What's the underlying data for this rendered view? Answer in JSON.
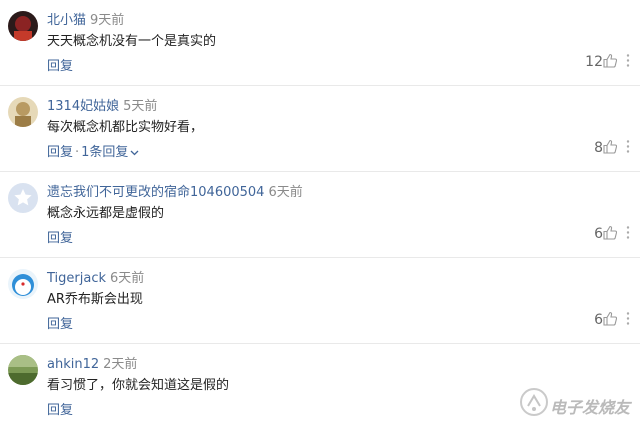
{
  "comments": [
    {
      "username": "北小猫",
      "time": "9天前",
      "text": "天天概念机没有一个是真实的",
      "reply_label": "回复",
      "likes": "12",
      "avatar_color": "#7a1f1f"
    },
    {
      "username": "1314妃姑娘",
      "time": "5天前",
      "text": "每次概念机都比实物好看，",
      "reply_label": "回复",
      "replies_label": "1条回复",
      "likes": "8",
      "avatar_color": "#c9b58a"
    },
    {
      "username": "遗忘我们不可更改的宿命104600504",
      "time": "6天前",
      "text": "概念永远都是虚假的",
      "reply_label": "回复",
      "likes": "6",
      "avatar_color": "#c7d3e6"
    },
    {
      "username": "Tigerjack",
      "time": "6天前",
      "text": "AR乔布斯会出现",
      "reply_label": "回复",
      "likes": "6",
      "avatar_color": "#3a9ad9"
    },
    {
      "username": "ahkin12",
      "time": "2天前",
      "text": "看习惯了，你就会知道这是假的",
      "reply_label": "回复",
      "avatar_color": "#5c7a3a"
    }
  ],
  "separator": "·",
  "watermark": {
    "text": "电子发烧友"
  },
  "colors": {
    "link": "#406599",
    "meta": "#8a8a8a",
    "text": "#222222"
  }
}
